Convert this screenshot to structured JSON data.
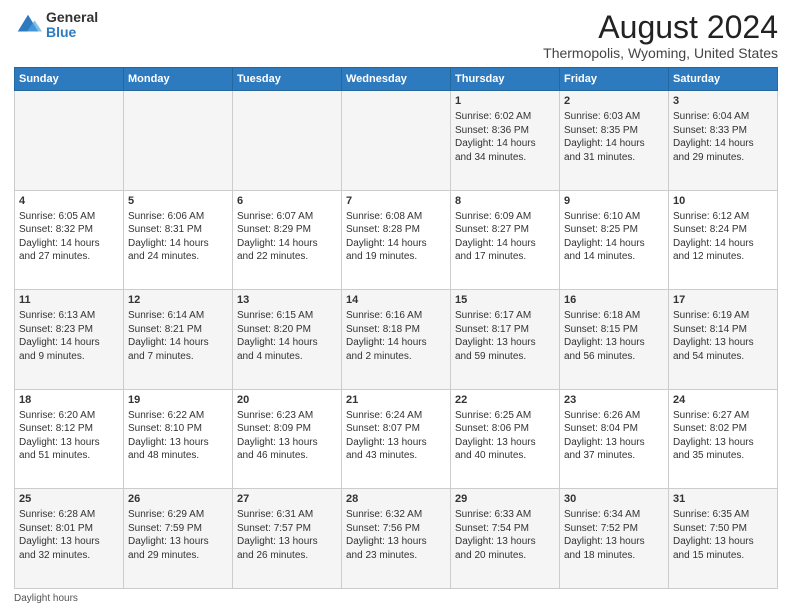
{
  "logo": {
    "general": "General",
    "blue": "Blue"
  },
  "title": "August 2024",
  "subtitle": "Thermopolis, Wyoming, United States",
  "weekdays": [
    "Sunday",
    "Monday",
    "Tuesday",
    "Wednesday",
    "Thursday",
    "Friday",
    "Saturday"
  ],
  "weeks": [
    [
      {
        "day": "",
        "info": ""
      },
      {
        "day": "",
        "info": ""
      },
      {
        "day": "",
        "info": ""
      },
      {
        "day": "",
        "info": ""
      },
      {
        "day": "1",
        "info": "Sunrise: 6:02 AM\nSunset: 8:36 PM\nDaylight: 14 hours and 34 minutes."
      },
      {
        "day": "2",
        "info": "Sunrise: 6:03 AM\nSunset: 8:35 PM\nDaylight: 14 hours and 31 minutes."
      },
      {
        "day": "3",
        "info": "Sunrise: 6:04 AM\nSunset: 8:33 PM\nDaylight: 14 hours and 29 minutes."
      }
    ],
    [
      {
        "day": "4",
        "info": "Sunrise: 6:05 AM\nSunset: 8:32 PM\nDaylight: 14 hours and 27 minutes."
      },
      {
        "day": "5",
        "info": "Sunrise: 6:06 AM\nSunset: 8:31 PM\nDaylight: 14 hours and 24 minutes."
      },
      {
        "day": "6",
        "info": "Sunrise: 6:07 AM\nSunset: 8:29 PM\nDaylight: 14 hours and 22 minutes."
      },
      {
        "day": "7",
        "info": "Sunrise: 6:08 AM\nSunset: 8:28 PM\nDaylight: 14 hours and 19 minutes."
      },
      {
        "day": "8",
        "info": "Sunrise: 6:09 AM\nSunset: 8:27 PM\nDaylight: 14 hours and 17 minutes."
      },
      {
        "day": "9",
        "info": "Sunrise: 6:10 AM\nSunset: 8:25 PM\nDaylight: 14 hours and 14 minutes."
      },
      {
        "day": "10",
        "info": "Sunrise: 6:12 AM\nSunset: 8:24 PM\nDaylight: 14 hours and 12 minutes."
      }
    ],
    [
      {
        "day": "11",
        "info": "Sunrise: 6:13 AM\nSunset: 8:23 PM\nDaylight: 14 hours and 9 minutes."
      },
      {
        "day": "12",
        "info": "Sunrise: 6:14 AM\nSunset: 8:21 PM\nDaylight: 14 hours and 7 minutes."
      },
      {
        "day": "13",
        "info": "Sunrise: 6:15 AM\nSunset: 8:20 PM\nDaylight: 14 hours and 4 minutes."
      },
      {
        "day": "14",
        "info": "Sunrise: 6:16 AM\nSunset: 8:18 PM\nDaylight: 14 hours and 2 minutes."
      },
      {
        "day": "15",
        "info": "Sunrise: 6:17 AM\nSunset: 8:17 PM\nDaylight: 13 hours and 59 minutes."
      },
      {
        "day": "16",
        "info": "Sunrise: 6:18 AM\nSunset: 8:15 PM\nDaylight: 13 hours and 56 minutes."
      },
      {
        "day": "17",
        "info": "Sunrise: 6:19 AM\nSunset: 8:14 PM\nDaylight: 13 hours and 54 minutes."
      }
    ],
    [
      {
        "day": "18",
        "info": "Sunrise: 6:20 AM\nSunset: 8:12 PM\nDaylight: 13 hours and 51 minutes."
      },
      {
        "day": "19",
        "info": "Sunrise: 6:22 AM\nSunset: 8:10 PM\nDaylight: 13 hours and 48 minutes."
      },
      {
        "day": "20",
        "info": "Sunrise: 6:23 AM\nSunset: 8:09 PM\nDaylight: 13 hours and 46 minutes."
      },
      {
        "day": "21",
        "info": "Sunrise: 6:24 AM\nSunset: 8:07 PM\nDaylight: 13 hours and 43 minutes."
      },
      {
        "day": "22",
        "info": "Sunrise: 6:25 AM\nSunset: 8:06 PM\nDaylight: 13 hours and 40 minutes."
      },
      {
        "day": "23",
        "info": "Sunrise: 6:26 AM\nSunset: 8:04 PM\nDaylight: 13 hours and 37 minutes."
      },
      {
        "day": "24",
        "info": "Sunrise: 6:27 AM\nSunset: 8:02 PM\nDaylight: 13 hours and 35 minutes."
      }
    ],
    [
      {
        "day": "25",
        "info": "Sunrise: 6:28 AM\nSunset: 8:01 PM\nDaylight: 13 hours and 32 minutes."
      },
      {
        "day": "26",
        "info": "Sunrise: 6:29 AM\nSunset: 7:59 PM\nDaylight: 13 hours and 29 minutes."
      },
      {
        "day": "27",
        "info": "Sunrise: 6:31 AM\nSunset: 7:57 PM\nDaylight: 13 hours and 26 minutes."
      },
      {
        "day": "28",
        "info": "Sunrise: 6:32 AM\nSunset: 7:56 PM\nDaylight: 13 hours and 23 minutes."
      },
      {
        "day": "29",
        "info": "Sunrise: 6:33 AM\nSunset: 7:54 PM\nDaylight: 13 hours and 20 minutes."
      },
      {
        "day": "30",
        "info": "Sunrise: 6:34 AM\nSunset: 7:52 PM\nDaylight: 13 hours and 18 minutes."
      },
      {
        "day": "31",
        "info": "Sunrise: 6:35 AM\nSunset: 7:50 PM\nDaylight: 13 hours and 15 minutes."
      }
    ]
  ],
  "footer": "Daylight hours"
}
